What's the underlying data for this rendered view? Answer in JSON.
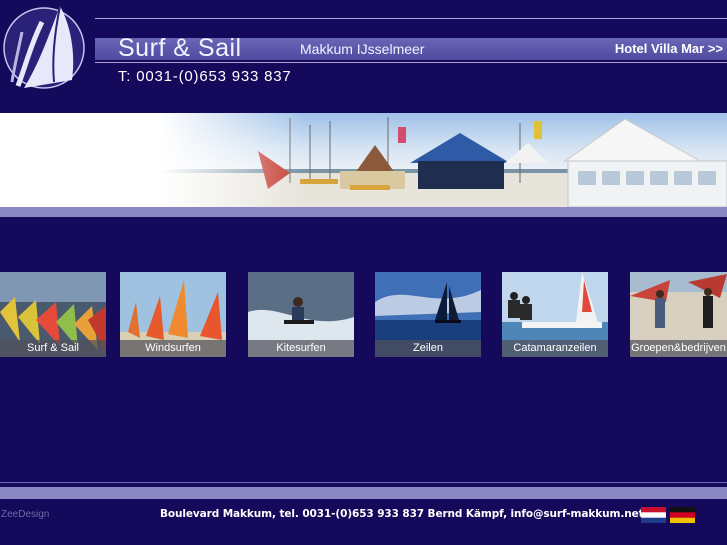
{
  "header": {
    "title": "Surf & Sail",
    "subtitle": "Makkum IJsselmeer",
    "hotel_link": "Hotel Villa Mar >>",
    "phone": "T: 0031-(0)653 933 837"
  },
  "tiles": [
    {
      "label": "Surf & Sail",
      "icon": "surf-sail-photo"
    },
    {
      "label": "Windsurfen",
      "icon": "windsurf-photo"
    },
    {
      "label": "Kitesurfen",
      "icon": "kitesurf-photo"
    },
    {
      "label": "Zeilen",
      "icon": "sailing-photo"
    },
    {
      "label": "Catamaranzeilen",
      "icon": "catamaran-photo"
    },
    {
      "label": "Groepen&bedrijven",
      "icon": "groups-photo"
    }
  ],
  "footer": {
    "credit": "ZeeDesign",
    "contact": "Boulevard Makkum, tel. 0031-(0)653 933 837 Bernd Kämpf, info@surf-makkum.net"
  },
  "colors": {
    "background": "#14095a",
    "bar": "#8a87c2",
    "brand_bar": "#5a55a8"
  }
}
